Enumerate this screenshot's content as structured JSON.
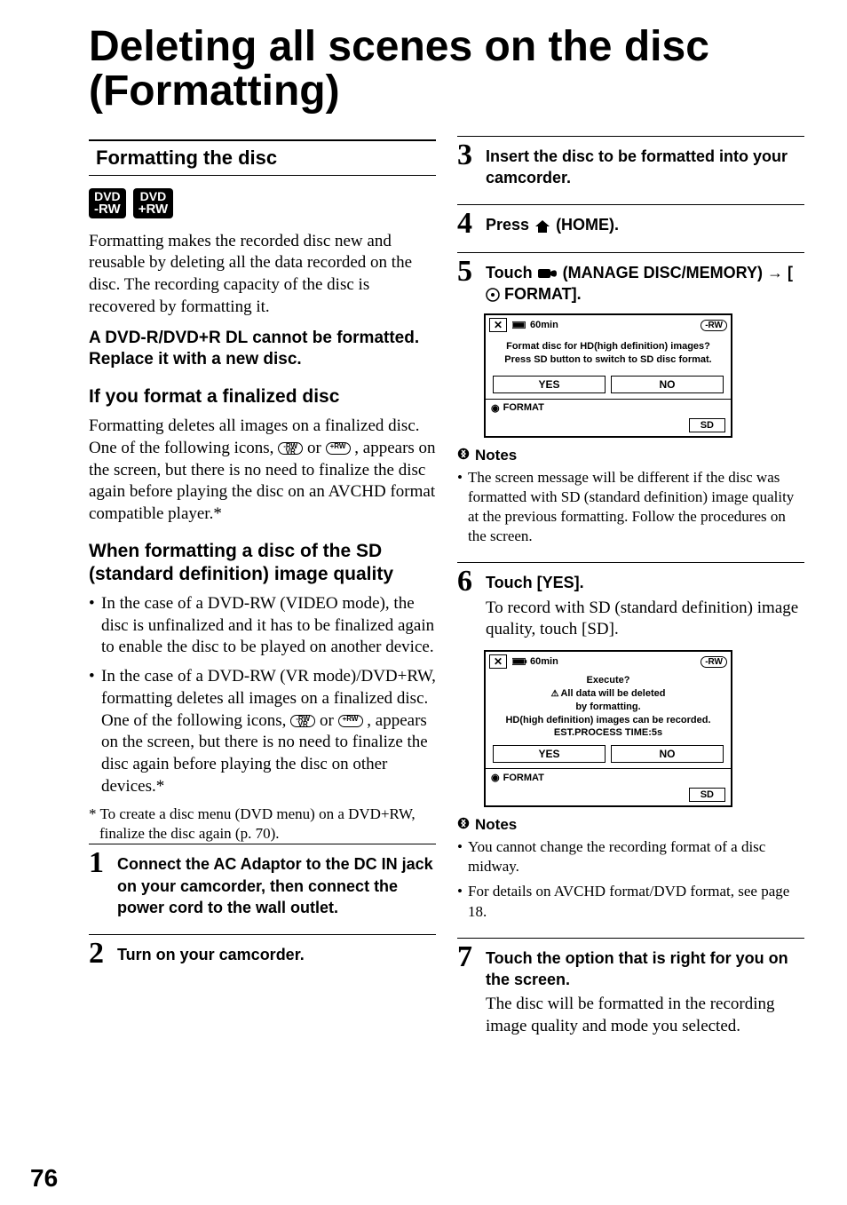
{
  "page_number": "76",
  "title": "Deleting all scenes on the disc (Formatting)",
  "left": {
    "section_heading": "Formatting the disc",
    "badges": [
      {
        "top": "DVD",
        "bottom": "-RW"
      },
      {
        "top": "DVD",
        "bottom": "+RW"
      }
    ],
    "intro": "Formatting makes the recorded disc new and reusable by deleting all the data recorded on the disc. The recording capacity of the disc is recovered by formatting it.",
    "warning": "A DVD-R/DVD+R DL cannot be formatted. Replace it with a new disc.",
    "sub1_h": "If you format a finalized disc",
    "sub1_body_a": "Formatting deletes all images on a finalized disc. One of the following icons, ",
    "sub1_body_b": " or ",
    "sub1_body_c": " , appears on the screen, but there is no need to finalize the disc again before playing the disc on an AVCHD format compatible player.*",
    "sub2_h": "When formatting a disc of the SD (standard definition) image quality",
    "sub2_bullets": [
      "In the case of a DVD-RW (VIDEO mode), the disc is unfinalized and it has to be finalized again to enable the disc to be played on another device.",
      {
        "pre": "In the case of a DVD-RW (VR mode)/DVD+RW, formatting deletes all images on a finalized disc. One of the following icons, ",
        "mid": " or ",
        "post": " , appears on the screen, but there is no need to finalize the disc again before playing the disc on other devices.*"
      }
    ],
    "footnote": "* To create a disc menu (DVD menu) on a DVD+RW, finalize the disc again (p. 70).",
    "steps": [
      {
        "n": "1",
        "head": "Connect the AC Adaptor to the DC IN jack on your camcorder, then connect the power cord to the wall outlet."
      },
      {
        "n": "2",
        "head": "Turn on your camcorder."
      }
    ]
  },
  "right": {
    "steps": [
      {
        "n": "3",
        "head": "Insert the disc to be formatted into your camcorder."
      },
      {
        "n": "4",
        "head_pre": "Press ",
        "icon": "home",
        "head_post": " (HOME)."
      },
      {
        "n": "5",
        "head_pre": "Touch ",
        "icon": "manage",
        "head_mid": " (MANAGE DISC/MEMORY) → [",
        "icon2": "disc",
        "head_post": "FORMAT]."
      },
      {
        "n": "6",
        "head": "Touch [YES].",
        "body": "To record with SD (standard definition) image quality, touch [SD]."
      },
      {
        "n": "7",
        "head": "Touch the option that is right for you on the screen.",
        "body": "The disc will be formatted in the recording image quality and mode you selected."
      }
    ],
    "lcd1": {
      "batt": "60min",
      "disc_tag": "-RW",
      "line1": "Format disc for HD(high definition) images?",
      "line2": "Press SD button to switch to SD disc format.",
      "yes": "YES",
      "no": "NO",
      "status": "FORMAT",
      "sd": "SD"
    },
    "notes1_label": "Notes",
    "notes1": [
      "The screen message will be different if the disc was formatted with SD (standard definition) image quality at the previous formatting. Follow the procedures on the screen."
    ],
    "lcd2": {
      "batt": "60min",
      "disc_tag": "-RW",
      "l1": "Execute?",
      "l2": "All data will be deleted",
      "l3": "by formatting.",
      "l4": "HD(high definition) images can be recorded.",
      "l5": "EST.PROCESS TIME:5s",
      "yes": "YES",
      "no": "NO",
      "status": "FORMAT",
      "sd": "SD"
    },
    "notes2_label": "Notes",
    "notes2": [
      "You cannot change the recording format of a disc midway.",
      "For details on AVCHD format/DVD format, see page 18."
    ]
  },
  "icons": {
    "rw_vr": "-RW VR",
    "plus_rw": "+RW"
  }
}
